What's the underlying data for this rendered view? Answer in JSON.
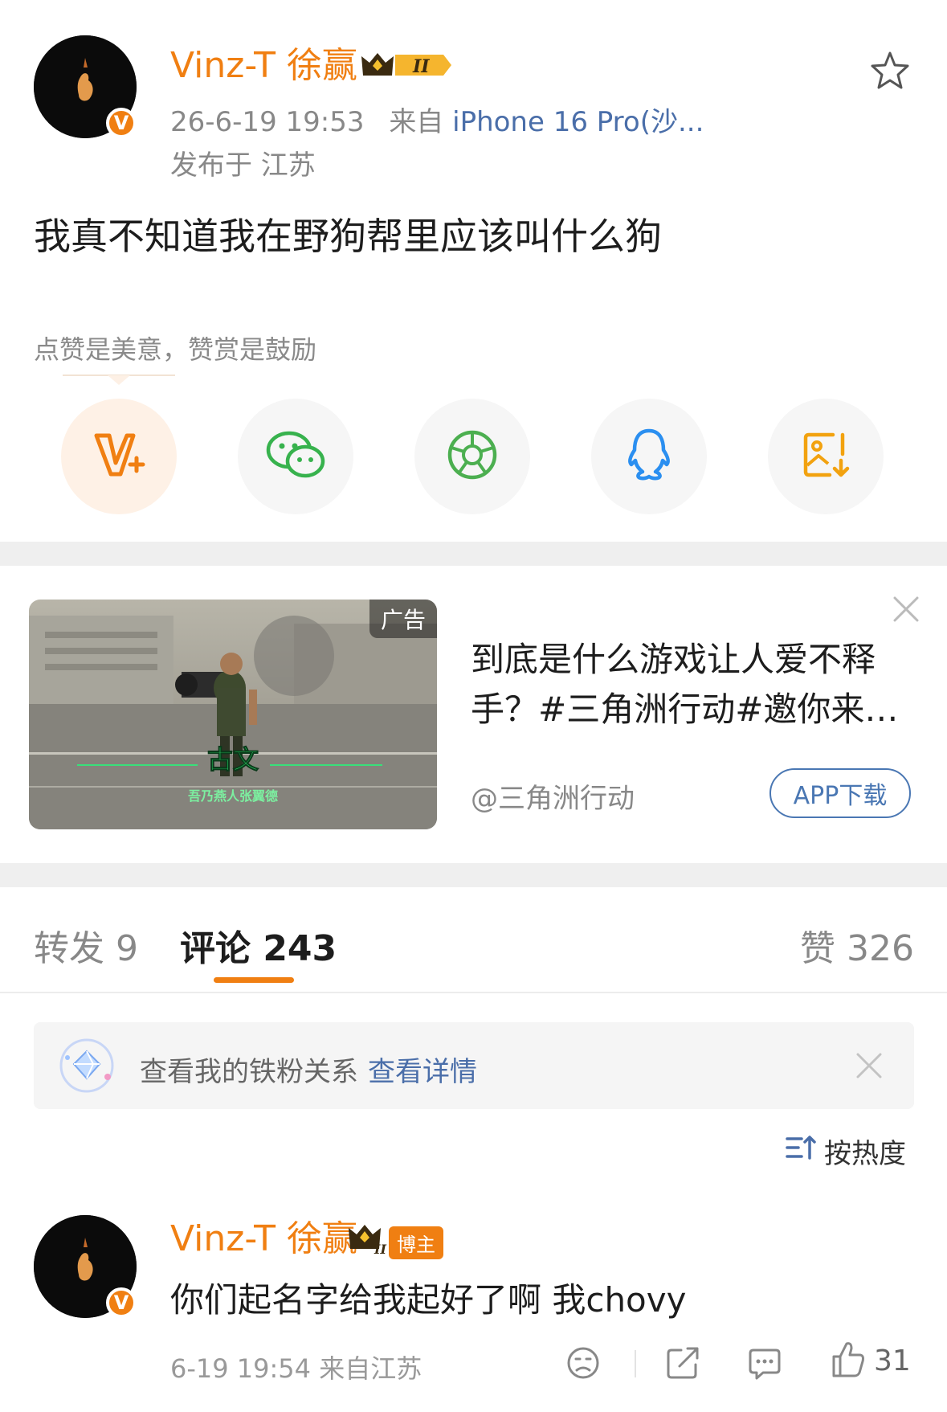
{
  "post": {
    "username": "Vinz-T 徐赢",
    "level": "II",
    "date": "26-6-19 19:53",
    "source_prefix": "来自",
    "device": "iPhone 16 Pro(沙...",
    "location": "发布于 江苏",
    "text": "我真不知道我在野狗帮里应该叫什么狗",
    "reward_tip": "点赞是美意，赞赏是鼓励"
  },
  "share": {
    "icons": [
      "v-plus-icon",
      "wechat-icon",
      "moments-icon",
      "qq-icon",
      "save-image-icon"
    ]
  },
  "ad": {
    "tag": "广告",
    "title": "到底是什么游戏让人爱不释手？#三角洲行动#邀你来…",
    "source": "@三角洲行动",
    "button": "APP下载",
    "overlay_title": "古文",
    "overlay_sub": "吾乃燕人张翼德"
  },
  "tabs": {
    "repost": "转发 9",
    "comment": "评论 243",
    "like": "赞 326"
  },
  "fans_bar": {
    "text": "查看我的铁粉关系",
    "link": "查看详情"
  },
  "sort": {
    "label": "按热度"
  },
  "comment": {
    "username": "Vinz-T 徐赢",
    "badge": "博主",
    "level": "II",
    "text": "你们起名字给我起好了啊 我chovy",
    "meta": "6-19 19:54  来自江苏",
    "likes": "31"
  },
  "colors": {
    "brand_orange": "#f07f12",
    "link_blue": "#4a6ea9"
  }
}
